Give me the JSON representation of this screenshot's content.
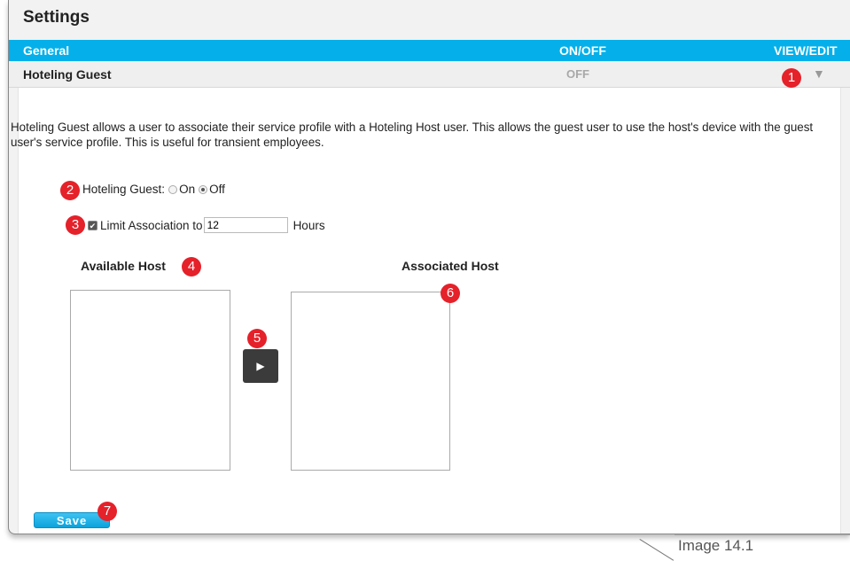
{
  "header": {
    "title": "Settings"
  },
  "section_bar": {
    "general": "General",
    "on_off": "ON/OFF",
    "view_edit": "VIEW/EDIT"
  },
  "feature_row": {
    "name": "Hoteling Guest",
    "state": "OFF",
    "expand_icon": "caret-down-icon"
  },
  "description": "Hoteling Guest allows a user to associate their service profile with a Hoteling Host user. This allows the guest user to use the host's device with the guest user's service profile. This is useful for transient employees.",
  "hoteling_guest_toggle": {
    "label": "Hoteling Guest:",
    "on_label": "On",
    "off_label": "Off",
    "selected": "Off"
  },
  "limit_association": {
    "label": "Limit Association to",
    "checked": true,
    "value": "12",
    "unit": "Hours"
  },
  "hosts": {
    "available_label": "Available Host",
    "associated_label": "Associated Host",
    "move_icon": "play-right-icon"
  },
  "save_label": "Save",
  "callouts": [
    "1",
    "2",
    "3",
    "4",
    "5",
    "6",
    "7"
  ],
  "caption": "Image 14.1",
  "colors": {
    "accent_blue": "#05b0ea",
    "callout_red": "#e5212a",
    "move_button": "#3b3b3b"
  }
}
